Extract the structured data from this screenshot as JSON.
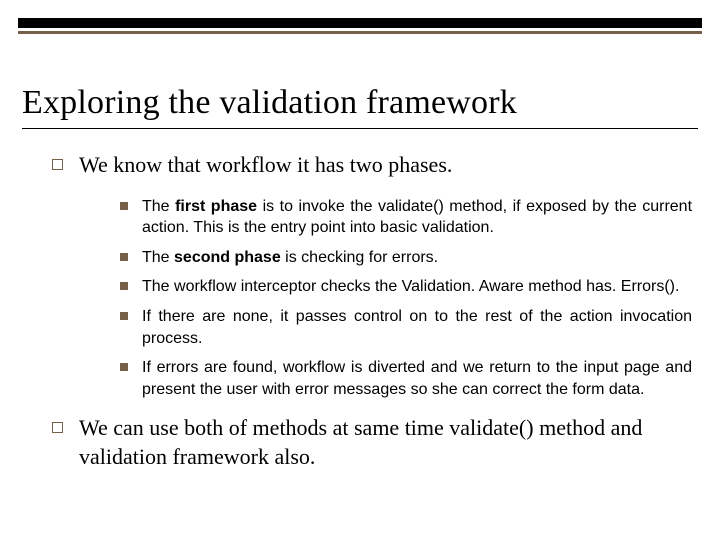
{
  "title": "Exploring the validation framework",
  "items": [
    {
      "text": "We know that workflow it has two phases.",
      "sub": [
        {
          "bold": "first phase",
          "rest": "is to invoke the validate() method, if exposed by the current action. This is the entry point into basic validation."
        },
        {
          "bold": "second phase",
          "rest": "is checking for errors."
        },
        {
          "text": "The workflow interceptor checks the Validation. Aware method has. Errors()."
        },
        {
          "text": "If there are none, it passes control on to the rest of the action invocation process."
        },
        {
          "text": "If  errors are found, workflow is diverted and we return to the input page and present the user with error messages so she can correct the form data."
        }
      ]
    },
    {
      "text": "We can use both of methods at same time validate() method and validation framework also."
    }
  ],
  "colors": {
    "accent": "#756047"
  }
}
